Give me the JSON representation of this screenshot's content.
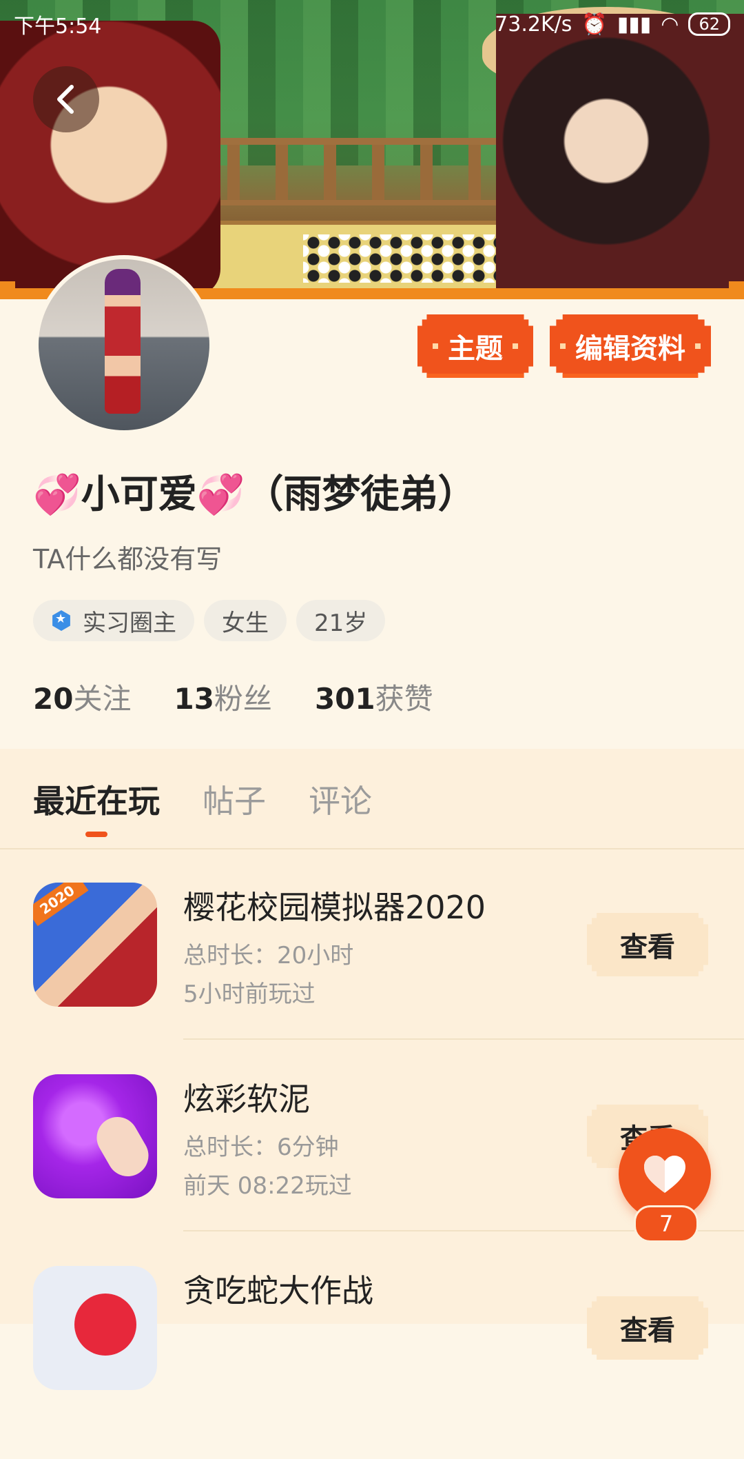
{
  "status_bar": {
    "time": "下午5:54",
    "network_speed": "73.2K/s",
    "battery": "62"
  },
  "header": {
    "theme_button": "主题",
    "edit_button": "编辑资料"
  },
  "profile": {
    "nickname": "💞小可爱💞（雨梦徒弟）",
    "bio": "TA什么都没有写",
    "tags": [
      "实习圈主",
      "女生",
      "21岁"
    ],
    "stats": [
      {
        "num": "20",
        "label": "关注"
      },
      {
        "num": "13",
        "label": "粉丝"
      },
      {
        "num": "301",
        "label": "获赞"
      }
    ]
  },
  "tabs": [
    "最近在玩",
    "帖子",
    "评论"
  ],
  "games": [
    {
      "title": "樱花校园模拟器2020",
      "duration": "总时长：20小时",
      "last_played": "5小时前玩过",
      "action": "查看",
      "icon_badge": "2020"
    },
    {
      "title": "炫彩软泥",
      "duration": "总时长：6分钟",
      "last_played": "前天 08:22玩过",
      "action": "查看"
    },
    {
      "title": "贪吃蛇大作战",
      "duration": "",
      "last_played": "",
      "action": "查看"
    }
  ],
  "like": {
    "count": "7"
  },
  "colors": {
    "accent": "#f0531c",
    "background": "#fdf6e8",
    "list_background": "#fdf0dc"
  }
}
